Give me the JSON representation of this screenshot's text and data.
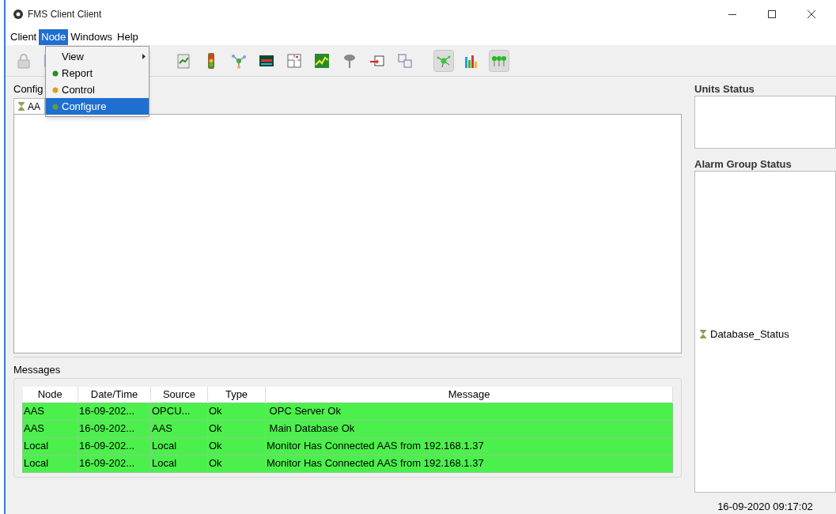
{
  "window": {
    "title": "FMS Client Client"
  },
  "menu_bar": [
    {
      "label": "Client",
      "selected": false
    },
    {
      "label": "Node",
      "selected": true
    },
    {
      "label": "Windows",
      "selected": false
    },
    {
      "label": "Help",
      "selected": false
    }
  ],
  "node_menu": [
    {
      "label": "View",
      "kind": "submenu",
      "selected": false
    },
    {
      "label": "Report",
      "kind": "item",
      "selected": false
    },
    {
      "label": "Control",
      "kind": "item",
      "selected": false
    },
    {
      "label": "Configure",
      "kind": "item",
      "selected": true
    }
  ],
  "toolbar": [
    {
      "kind": "lock",
      "pressed": false
    },
    {
      "kind": "window",
      "pressed": false
    },
    {
      "kind": "doc",
      "pressed": false
    },
    {
      "kind": "traffic",
      "pressed": false
    },
    {
      "kind": "network",
      "pressed": false
    },
    {
      "kind": "screen",
      "pressed": false
    },
    {
      "kind": "plan",
      "pressed": false
    },
    {
      "kind": "trend",
      "pressed": false
    },
    {
      "kind": "pin",
      "pressed": false
    },
    {
      "kind": "transfer",
      "pressed": false
    },
    {
      "kind": "cubes",
      "pressed": false
    },
    {
      "kind": "molecule",
      "pressed": true
    },
    {
      "kind": "bars",
      "pressed": false
    },
    {
      "kind": "trees",
      "pressed": true
    }
  ],
  "configure_panel": {
    "title": "Config",
    "tab": "AA"
  },
  "messages": {
    "title": "Messages",
    "columns": [
      "Node",
      "Date/Time",
      "Source",
      "Type",
      "Message"
    ],
    "rows": [
      [
        "AAS",
        "16-09-202...",
        "OPCU...",
        "Ok",
        " OPC Server Ok"
      ],
      [
        "AAS",
        "16-09-202...",
        "AAS",
        "Ok",
        " Main Database Ok"
      ],
      [
        "Local",
        "16-09-202...",
        "Local",
        "Ok",
        "Monitor Has Connected AAS from 192.168.1.37"
      ],
      [
        "Local",
        "16-09-202...",
        "Local",
        "Ok",
        "Monitor Has Connected AAS from 192.168.1.37"
      ]
    ]
  },
  "units_status": {
    "title": "Units Status"
  },
  "alarm_group_status": {
    "title": "Alarm Group Status",
    "items": [
      "Database_Status"
    ]
  },
  "status_bar": {
    "time": "16-09-2020 09:17:02"
  }
}
